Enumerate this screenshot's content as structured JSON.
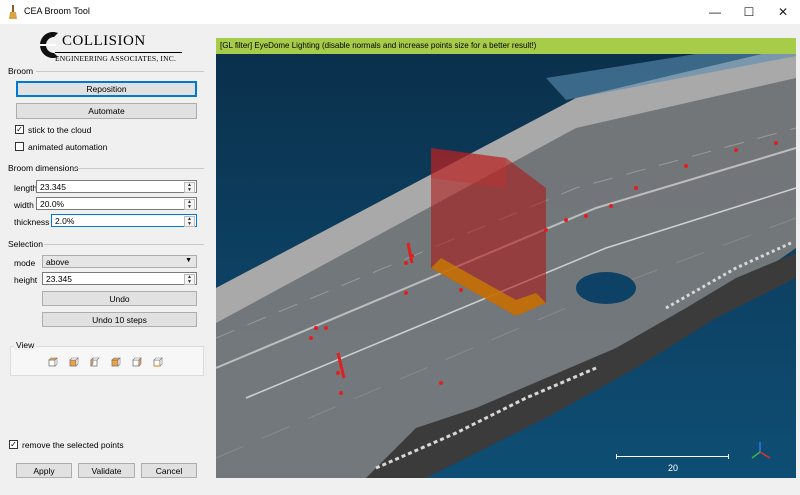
{
  "window": {
    "title": "CEA Broom Tool",
    "buttons": [
      "—",
      "☐",
      "✕"
    ]
  },
  "logo": {
    "name": "COLLISION",
    "subtitle": "ENGINEERING ASSOCIATES, INC."
  },
  "broom": {
    "title": "Broom",
    "reposition_label": "Reposition",
    "automate_label": "Automate",
    "stick_label": "stick to the cloud",
    "stick_checked": true,
    "animated_label": "animated automation",
    "animated_checked": false
  },
  "dimensions": {
    "title": "Broom dimensions",
    "length_label": "length",
    "length_value": "23.345",
    "width_label": "width",
    "width_value": "20.0%",
    "thickness_label": "thickness",
    "thickness_value": "2.0%"
  },
  "selection": {
    "title": "Selection",
    "mode_label": "mode",
    "mode_value": "above",
    "height_label": "height",
    "height_value": "23.345",
    "undo_label": "Undo",
    "undo10_label": "Undo 10 steps"
  },
  "view": {
    "title": "View",
    "icons": [
      "cube-top-icon",
      "cube-front-icon",
      "cube-left-icon",
      "cube-back-icon",
      "cube-right-icon",
      "cube-bottom-icon"
    ]
  },
  "bottom": {
    "remove_label": "remove the selected points",
    "remove_checked": true,
    "apply_label": "Apply",
    "validate_label": "Validate",
    "cancel_label": "Cancel"
  },
  "gl": {
    "filter_text": "[GL filter] EyeDome Lighting (disable normals and increase points size for a better result!)",
    "scale_value": "20"
  },
  "colors": {
    "accent": "#0078d7",
    "gl_bar": "#a7cc4a",
    "broom_red": "#b01010",
    "broom_orange": "#c87a00"
  }
}
